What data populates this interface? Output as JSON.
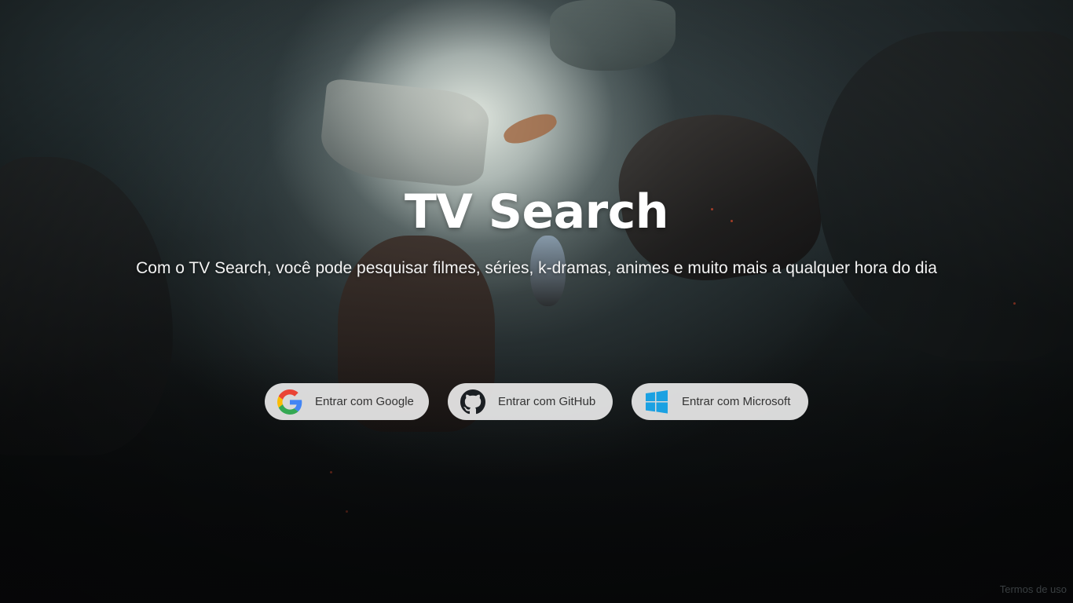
{
  "hero": {
    "title": "TV Search",
    "subtitle": "Com o TV Search, você pode pesquisar filmes, séries, k-dramas, animes e muito mais a qualquer hora do dia"
  },
  "login": {
    "google_label": "Entrar com Google",
    "github_label": "Entrar com GitHub",
    "microsoft_label": "Entrar com Microsoft",
    "icons": [
      "google-icon",
      "github-icon",
      "windows-icon"
    ]
  },
  "footer": {
    "terms_label": "Termos de uso"
  },
  "colors": {
    "button_background": "#e8e8e8",
    "text_primary": "#ffffff",
    "google_blue": "#4285F4",
    "google_red": "#EA4335",
    "google_yellow": "#FBBC05",
    "google_green": "#34A853",
    "windows_blue": "#1ba1e2"
  }
}
